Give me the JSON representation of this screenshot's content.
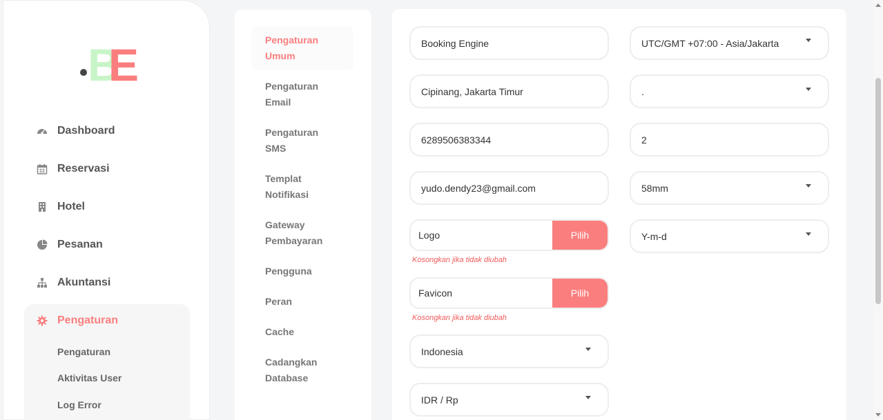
{
  "colors": {
    "accent": "#fb7e7e",
    "logo_green": "#c8f5c8",
    "logo_red": "#fb7e7e"
  },
  "logo": {
    "text": "BE"
  },
  "sidebar": {
    "items": [
      {
        "label": "Dashboard",
        "icon": "dashboard-icon"
      },
      {
        "label": "Reservasi",
        "icon": "calendar-icon"
      },
      {
        "label": "Hotel",
        "icon": "building-icon"
      },
      {
        "label": "Pesanan",
        "icon": "pie-chart-icon"
      },
      {
        "label": "Akuntansi",
        "icon": "sitemap-icon"
      },
      {
        "label": "Pengaturan",
        "icon": "gear-icon"
      }
    ],
    "sub_items": [
      "Pengaturan",
      "Aktivitas User",
      "Log Error"
    ]
  },
  "settings_menu": [
    "Pengaturan Umum",
    "Pengaturan Email",
    "Pengaturan SMS",
    "Templat Notifikasi",
    "Gateway Pembayaran",
    "Pengguna",
    "Peran",
    "Cache",
    "Cadangkan Database"
  ],
  "form": {
    "name": "Booking Engine",
    "address": "Cipinang, Jakarta Timur",
    "phone": "6289506383344",
    "email": "yudo.dendy23@gmail.com",
    "logo_file": "Logo",
    "favicon_file": "Favicon",
    "pick_label": "Pilih",
    "hint": "Kosongkan jika tidak diubah",
    "language": "Indonesia",
    "currency": "IDR / Rp",
    "timezone": "UTC/GMT +07:00 - Asia/Jakarta",
    "separator": ".",
    "decimals": "2",
    "paper": "58mm",
    "date_format": "Y-m-d"
  }
}
